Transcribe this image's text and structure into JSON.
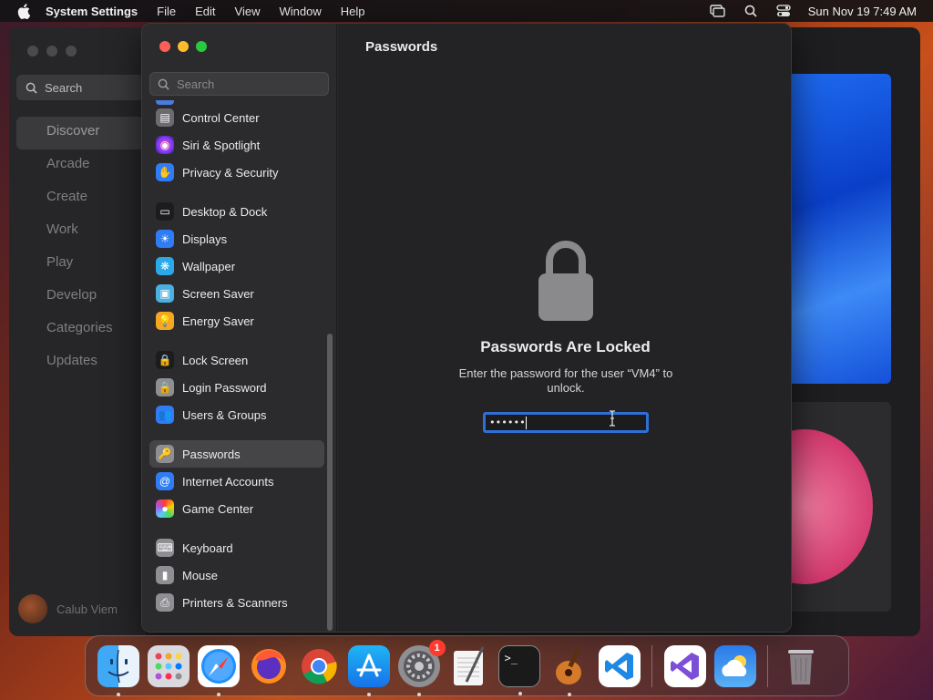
{
  "menubar": {
    "app_name": "System Settings",
    "menus": [
      "File",
      "Edit",
      "View",
      "Window",
      "Help"
    ],
    "datetime": "Sun Nov 19  7:49 AM"
  },
  "appstore_bg": {
    "search_placeholder": "Search",
    "nav": [
      "Discover",
      "Arcade",
      "Create",
      "Work",
      "Play",
      "Develop",
      "Categories",
      "Updates"
    ],
    "selected": "Discover",
    "user_name": "Calub Viem"
  },
  "settings": {
    "search_placeholder": "Search",
    "sidebar": [
      {
        "label": "Control Center",
        "icon": "control-center-icon",
        "color": "#6b6b70"
      },
      {
        "label": "Siri & Spotlight",
        "icon": "siri-icon",
        "color": "#b03aa8"
      },
      {
        "label": "Privacy & Security",
        "icon": "hand-icon",
        "color": "#2f7df6"
      },
      {
        "label": "Desktop & Dock",
        "icon": "desktop-dock-icon",
        "color": "#1c1c1e",
        "group_start": true
      },
      {
        "label": "Displays",
        "icon": "sun-icon",
        "color": "#2f7df6"
      },
      {
        "label": "Wallpaper",
        "icon": "wallpaper-icon",
        "color": "#2aa8e8"
      },
      {
        "label": "Screen Saver",
        "icon": "screen-saver-icon",
        "color": "#4ab0e0"
      },
      {
        "label": "Energy Saver",
        "icon": "lightbulb-icon",
        "color": "#f5a623"
      },
      {
        "label": "Lock Screen",
        "icon": "lock-screen-icon",
        "color": "#1c1c1e",
        "group_start": true
      },
      {
        "label": "Login Password",
        "icon": "login-password-icon",
        "color": "#8e8e93"
      },
      {
        "label": "Users & Groups",
        "icon": "users-icon",
        "color": "#2f7df6"
      },
      {
        "label": "Passwords",
        "icon": "key-icon",
        "color": "#8e8e93",
        "group_start": true,
        "selected": true
      },
      {
        "label": "Internet Accounts",
        "icon": "at-icon",
        "color": "#2f7df6"
      },
      {
        "label": "Game Center",
        "icon": "game-center-icon",
        "color": "#f0f0f0"
      },
      {
        "label": "Keyboard",
        "icon": "keyboard-icon",
        "color": "#8e8e93",
        "group_start": true
      },
      {
        "label": "Mouse",
        "icon": "mouse-icon",
        "color": "#8e8e93"
      },
      {
        "label": "Printers & Scanners",
        "icon": "printer-icon",
        "color": "#8e8e93"
      }
    ],
    "main": {
      "title": "Passwords",
      "locked_title": "Passwords Are Locked",
      "locked_desc": "Enter the password for the user “VM4” to unlock.",
      "password_value": "••••••"
    }
  },
  "dock": {
    "apps": [
      {
        "name": "Finder",
        "icon": "finder-icon",
        "running": true
      },
      {
        "name": "Launchpad",
        "icon": "launchpad-icon",
        "running": false
      },
      {
        "name": "Safari",
        "icon": "safari-icon",
        "running": true
      },
      {
        "name": "Firefox",
        "icon": "firefox-icon",
        "running": false
      },
      {
        "name": "Chrome",
        "icon": "chrome-icon",
        "running": false
      },
      {
        "name": "App Store",
        "icon": "app-store-icon",
        "running": true
      },
      {
        "name": "System Settings",
        "icon": "system-settings-icon",
        "running": true,
        "badge": "1"
      },
      {
        "name": "TextEdit",
        "icon": "textedit-icon",
        "running": false
      },
      {
        "name": "Terminal",
        "icon": "terminal-icon",
        "running": true
      },
      {
        "name": "Instruments",
        "icon": "instruments-icon",
        "running": true
      },
      {
        "name": "VS Code",
        "icon": "vscode-icon",
        "running": false
      }
    ],
    "recent": [
      {
        "name": "Visual Studio",
        "icon": "visual-studio-icon"
      },
      {
        "name": "Weather",
        "icon": "weather-icon"
      }
    ],
    "trash_label": "Trash"
  }
}
